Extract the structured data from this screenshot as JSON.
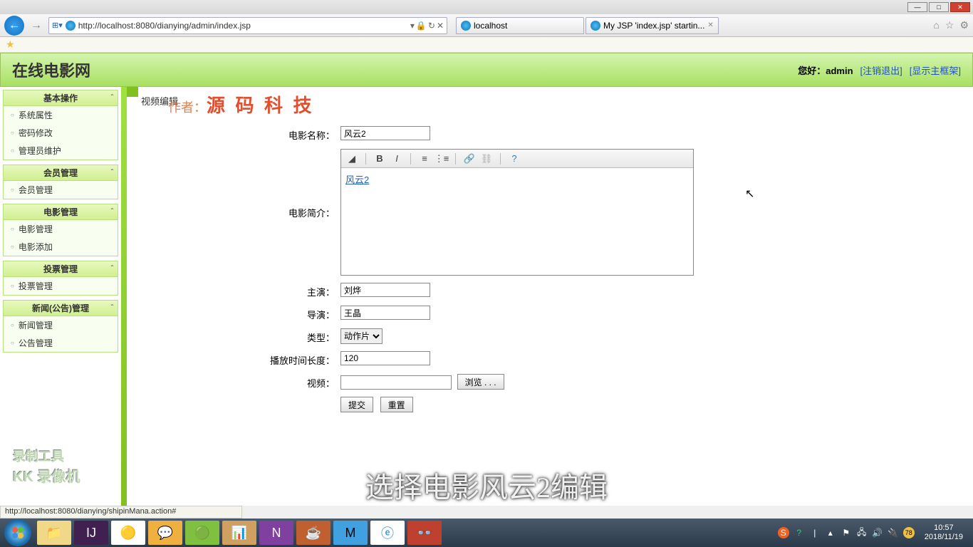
{
  "browser": {
    "url": "http://localhost:8080/dianying/admin/index.jsp",
    "tabs": [
      {
        "title": "localhost"
      },
      {
        "title": "My JSP 'index.jsp' startin..."
      }
    ]
  },
  "header": {
    "site_title": "在线电影网",
    "greeting": "您好：",
    "user": "admin",
    "logout": "[注销退出]",
    "show_frame": "[显示主框架]"
  },
  "sidebar": {
    "groups": [
      {
        "title": "基本操作",
        "items": [
          "系统属性",
          "密码修改",
          "管理员维护"
        ]
      },
      {
        "title": "会员管理",
        "items": [
          "会员管理"
        ]
      },
      {
        "title": "电影管理",
        "items": [
          "电影管理",
          "电影添加"
        ]
      },
      {
        "title": "投票管理",
        "items": [
          "投票管理"
        ]
      },
      {
        "title": "新闻(公告)管理",
        "items": [
          "新闻管理",
          "公告管理"
        ]
      }
    ]
  },
  "content": {
    "breadcrumb": "视频编辑",
    "author_label": "作者：",
    "brand": "源 码 科 技",
    "fields": {
      "name_label": "电影名称：",
      "name_value": "风云2",
      "desc_label": "电影简介：",
      "desc_link": "风云2",
      "starring_label": "主演：",
      "starring_value": "刘烨",
      "director_label": "导演：",
      "director_value": "王晶",
      "type_label": "类型：",
      "type_value": "动作片",
      "duration_label": "播放时间长度：",
      "duration_value": "120",
      "video_label": "视频：",
      "browse_btn": "浏览 . . .",
      "submit": "提交",
      "reset": "重置"
    }
  },
  "status_bar": "http://localhost:8080/dianying/shipinMana.action#",
  "overlay_caption": "选择电影风云2编辑",
  "watermark": {
    "line1": "录制工具",
    "line2": "KK 录像机"
  },
  "tray": {
    "time": "10:57",
    "date": "2018/11/19"
  }
}
